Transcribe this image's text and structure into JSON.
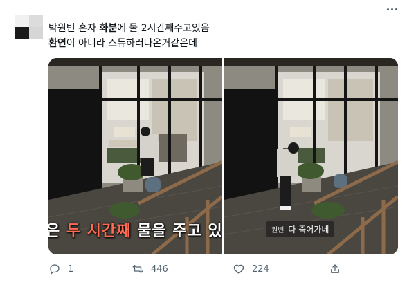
{
  "tweet": {
    "text_line1": {
      "seg1": "박원빈 혼자 ",
      "seg2_bold": "화분",
      "seg3": "에 물 2시간째주고있음"
    },
    "text_line2": {
      "seg1_bold": "환연",
      "seg2": "이 아니라 스듀하러나온거같은데"
    }
  },
  "media": {
    "left_caption": {
      "pre": "은 ",
      "highlight": "두 시간째",
      "post": " 물을 주고 있"
    },
    "right_caption": {
      "speaker": "원빈",
      "text": "다 죽어가네"
    }
  },
  "actions": {
    "reply_count": "1",
    "retweet_count": "446",
    "like_count": "224"
  },
  "colors": {
    "caption_highlight": "#ff6a52",
    "action_gray": "#536471"
  },
  "icons": [
    "more-icon",
    "reply-icon",
    "retweet-icon",
    "like-icon",
    "share-icon"
  ]
}
